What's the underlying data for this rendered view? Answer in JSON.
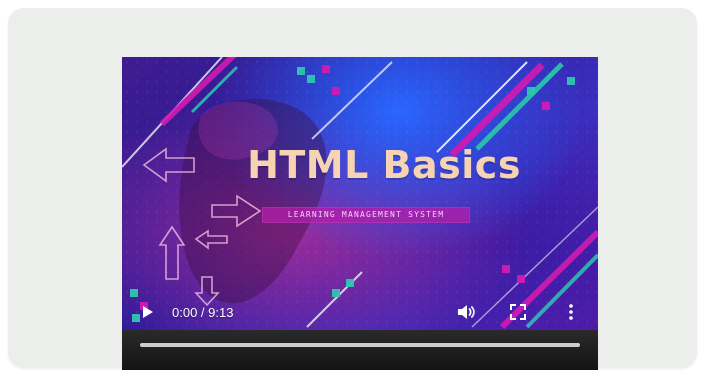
{
  "video": {
    "title": "HTML Basics",
    "subtitle": "LEARNING MANAGEMENT SYSTEM"
  },
  "controls": {
    "time_display": "0:00 / 9:13",
    "progress_fraction": 0.0,
    "play_icon": "play-icon",
    "volume_icon": "volume-icon",
    "fullscreen_icon": "fullscreen-icon",
    "more_icon": "more-vertical-icon"
  },
  "colors": {
    "card_background": "#eceeeb",
    "title": "#f6d3b2",
    "accent_magenta": "#d21ab2",
    "accent_teal": "#2fc6b0",
    "bottom_bar": "#1a1a1a"
  }
}
